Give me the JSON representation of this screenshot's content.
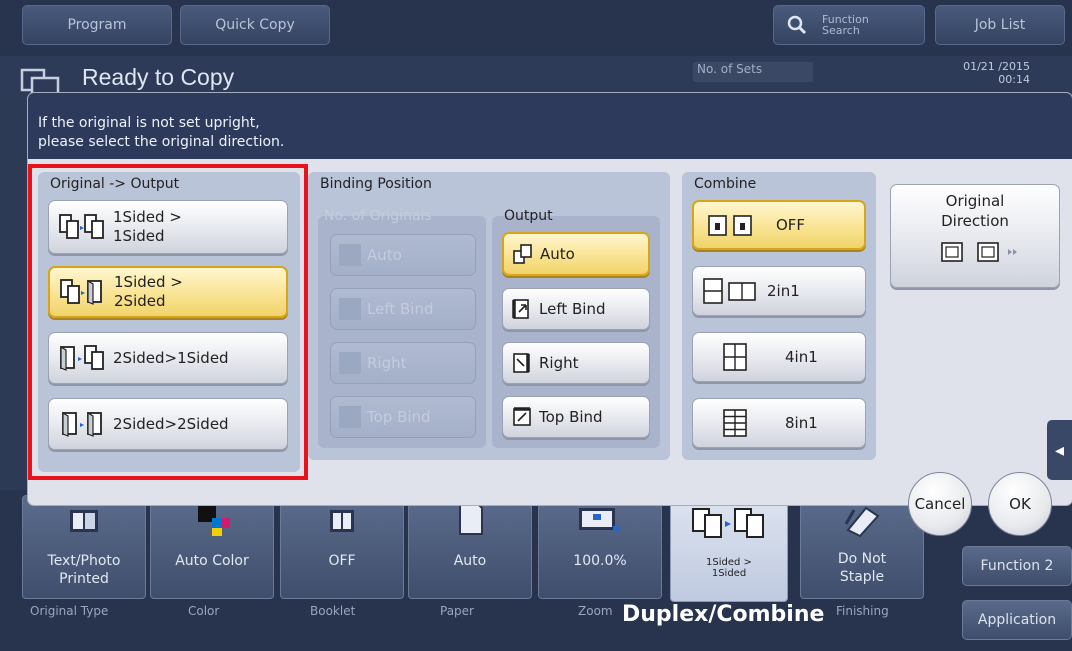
{
  "topbar": {
    "program": "Program",
    "quick_copy": "Quick Copy",
    "function_search": "Function\nSearch",
    "job_list": "Job List"
  },
  "header": {
    "title": "Ready to Copy",
    "sets_label": "No. of Sets",
    "datetime": "01/21 /2015\n00:14"
  },
  "dialog": {
    "message": "If the original is not set upright,\nplease select the original direction.",
    "original_output": {
      "label": "Original -> Output",
      "options": [
        "1Sided >\n1Sided",
        "1Sided >\n2Sided",
        "2Sided>1Sided",
        "2Sided>2Sided"
      ],
      "selected_index": 1
    },
    "binding": {
      "label": "Binding Position",
      "originals_label": "No. of Originals",
      "originals_options": [
        "Auto",
        "Left Bind",
        "Right",
        "Top Bind"
      ],
      "output_label": "Output",
      "output_options": [
        "Auto",
        "Left Bind",
        "Right",
        "Top Bind"
      ],
      "output_selected_index": 0
    },
    "combine": {
      "label": "Combine",
      "options": [
        "OFF",
        "2in1",
        "4in1",
        "8in1"
      ],
      "selected_index": 0
    },
    "original_direction": {
      "label": "Original\nDirection"
    },
    "cancel": "Cancel",
    "ok": "OK"
  },
  "bottom": {
    "tiles": [
      "Text/Photo\nPrinted",
      "Auto Color",
      "OFF",
      "Auto",
      "100.0%",
      "1Sided >\n1Sided",
      "Do Not\nStaple"
    ],
    "categories": [
      "Original Type",
      "Color",
      "Booklet",
      "Paper",
      "Zoom",
      "Duplex/Combine",
      "Finishing"
    ],
    "side_buttons": [
      "Function 2",
      "Application"
    ]
  },
  "colors": {
    "selection_highlight": "#e8121b",
    "selected_fill": "#f8e28e",
    "header_bg": "#2d3a5c"
  }
}
